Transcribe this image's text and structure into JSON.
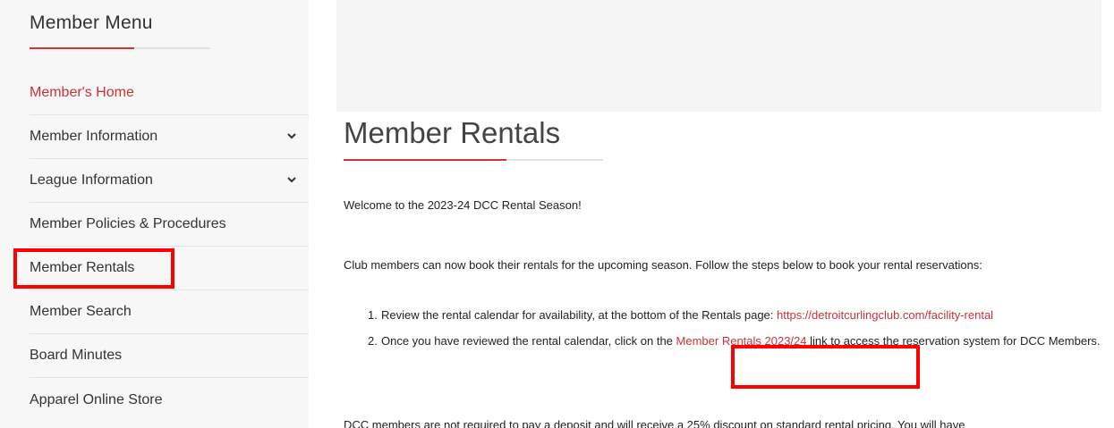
{
  "sidebar": {
    "title": "Member Menu",
    "items": [
      {
        "label": "Member's Home"
      },
      {
        "label": "Member Information"
      },
      {
        "label": "League Information"
      },
      {
        "label": "Member Policies & Procedures"
      },
      {
        "label": "Member Rentals"
      },
      {
        "label": "Member Search"
      },
      {
        "label": "Board Minutes"
      },
      {
        "label": "Apparel Online Store"
      }
    ]
  },
  "main": {
    "title": "Member Rentals",
    "welcome": "Welcome to the 2023-24 DCC Rental Season!",
    "intro": "Club members can now book their rentals for the upcoming season. Follow the steps below to book your rental reservations:",
    "step1": {
      "num": "1.",
      "text": "Review the rental calendar for availability, at the bottom of the Rentals page: ",
      "link": "https://detroitcurlingclub.com/facility-rental"
    },
    "step2": {
      "num": "2.",
      "text_before": "Once you have reviewed the rental calendar, click on the ",
      "link": "Member Rentals 2023/24",
      "text_after": " link to access the reservation system for DCC Members."
    },
    "footer": "DCC members are not required to pay a deposit and will receive a 25% discount on standard rental pricing. You will have"
  },
  "colors": {
    "accent": "#c8333b",
    "highlight": "#ff0000"
  }
}
